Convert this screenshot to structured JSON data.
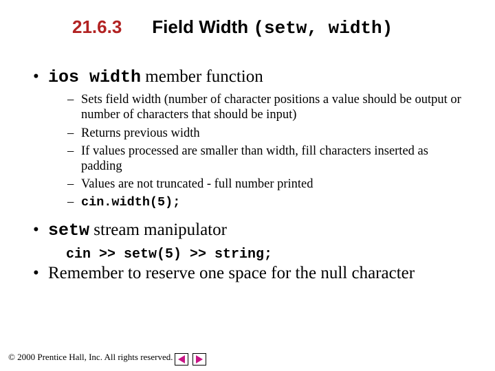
{
  "title": {
    "number": "21.6.3",
    "text_plain": "Field Width",
    "text_mono": "(setw, width)"
  },
  "bullets": [
    {
      "segments": [
        {
          "t": "ios width",
          "mono": true
        },
        {
          "t": " member function",
          "mono": false
        }
      ],
      "sub": [
        {
          "segments": [
            {
              "t": "Sets field width (number of character positions a value should be output or number of characters that should be input)",
              "mono": false
            }
          ]
        },
        {
          "segments": [
            {
              "t": "Returns previous width",
              "mono": false
            }
          ]
        },
        {
          "segments": [
            {
              "t": "If values processed are smaller than width, fill characters inserted as padding",
              "mono": false
            }
          ]
        },
        {
          "segments": [
            {
              "t": "Values are not truncated - full number printed",
              "mono": false
            }
          ]
        },
        {
          "segments": [
            {
              "t": "cin.width(5);",
              "mono": true
            }
          ]
        }
      ]
    },
    {
      "segments": [
        {
          "t": "setw",
          "mono": true
        },
        {
          "t": " stream manipulator",
          "mono": false
        }
      ],
      "code_after": "cin >> setw(5) >> string;"
    },
    {
      "segments": [
        {
          "t": "Remember to reserve one space for the null character",
          "mono": false
        }
      ]
    }
  ],
  "footer": "© 2000 Prentice Hall, Inc. All rights reserved.",
  "nav": {
    "prev": "prev",
    "next": "next"
  }
}
